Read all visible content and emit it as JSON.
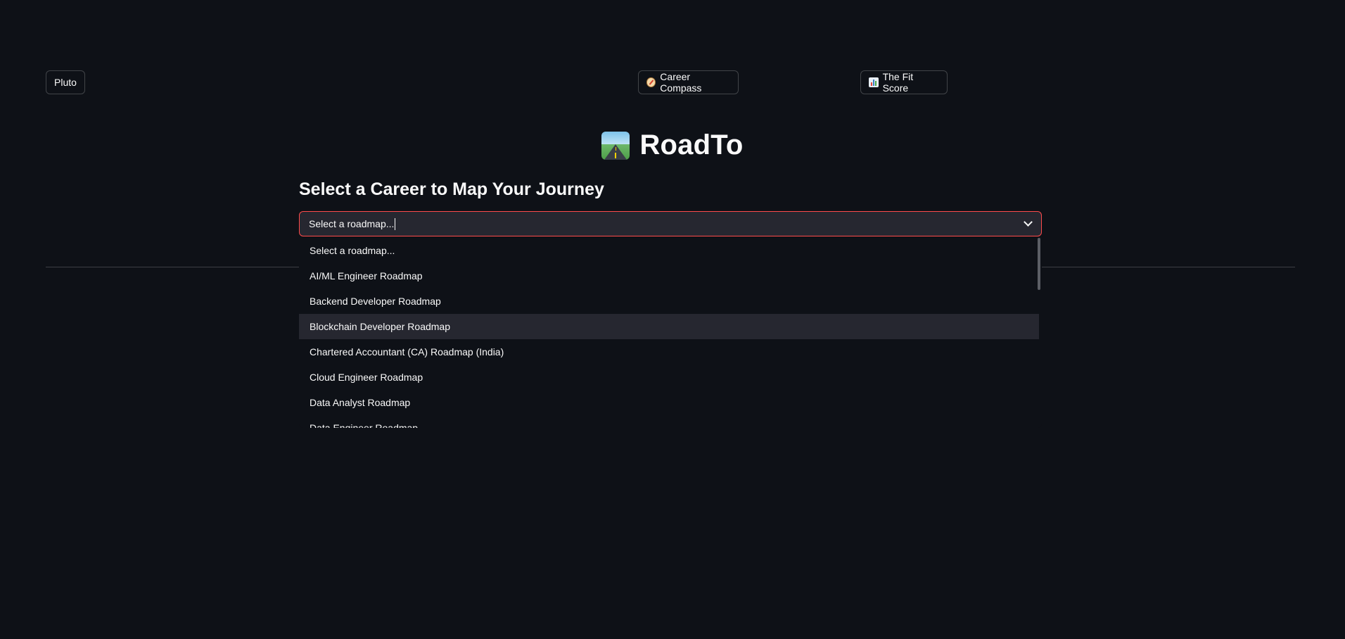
{
  "nav": {
    "pluto_label": "Pluto",
    "compass_label": "Career Compass",
    "compass_icon": "compass-icon",
    "fit_label": "The Fit Score",
    "fit_icon": "bar-chart-icon"
  },
  "header": {
    "title": "RoadTo",
    "icon": "motorway-icon"
  },
  "main": {
    "heading": "Select a Career to Map Your Journey",
    "select": {
      "value": "Select a roadmap...",
      "options": [
        "Select a roadmap...",
        "AI/ML Engineer Roadmap",
        "Backend Developer Roadmap",
        "Blockchain Developer Roadmap",
        "Chartered Accountant (CA) Roadmap (India)",
        "Cloud Engineer Roadmap",
        "Data Analyst Roadmap",
        "Data Engineer Roadmap"
      ],
      "highlighted_option": "Blockchain Developer Roadmap"
    }
  },
  "colors": {
    "background": "#0e1117",
    "accent": "#ff4b4b",
    "input_bg": "#262730"
  }
}
